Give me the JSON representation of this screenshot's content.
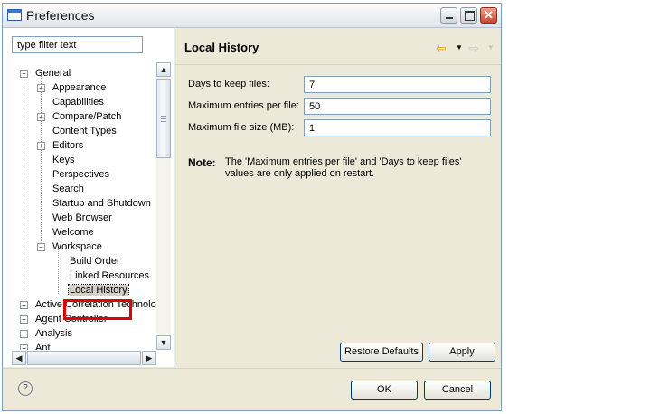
{
  "window": {
    "title": "Preferences"
  },
  "filter": {
    "placeholder": "type filter text"
  },
  "tree": [
    {
      "label": "General"
    },
    {
      "label": "Appearance"
    },
    {
      "label": "Capabilities"
    },
    {
      "label": "Compare/Patch"
    },
    {
      "label": "Content Types"
    },
    {
      "label": "Editors"
    },
    {
      "label": "Keys"
    },
    {
      "label": "Perspectives"
    },
    {
      "label": "Search"
    },
    {
      "label": "Startup and Shutdown"
    },
    {
      "label": "Web Browser"
    },
    {
      "label": "Welcome"
    },
    {
      "label": "Workspace"
    },
    {
      "label": "Build Order"
    },
    {
      "label": "Linked Resources"
    },
    {
      "label": "Local History"
    },
    {
      "label": "Active Correlation Technolog"
    },
    {
      "label": "Agent Controller"
    },
    {
      "label": "Analysis"
    },
    {
      "label": "Ant"
    }
  ],
  "page": {
    "title": "Local History",
    "fields": [
      {
        "label": "Days to keep files:",
        "value": "7"
      },
      {
        "label": "Maximum entries per file:",
        "value": "50"
      },
      {
        "label": "Maximum file size (MB):",
        "value": "1"
      }
    ],
    "note_label": "Note:",
    "note_text": "The 'Maximum entries per file' and 'Days to keep files' values are only applied on restart.",
    "restore_defaults": "Restore Defaults",
    "apply": "Apply"
  },
  "footer": {
    "ok": "OK",
    "cancel": "Cancel",
    "help": "?"
  }
}
